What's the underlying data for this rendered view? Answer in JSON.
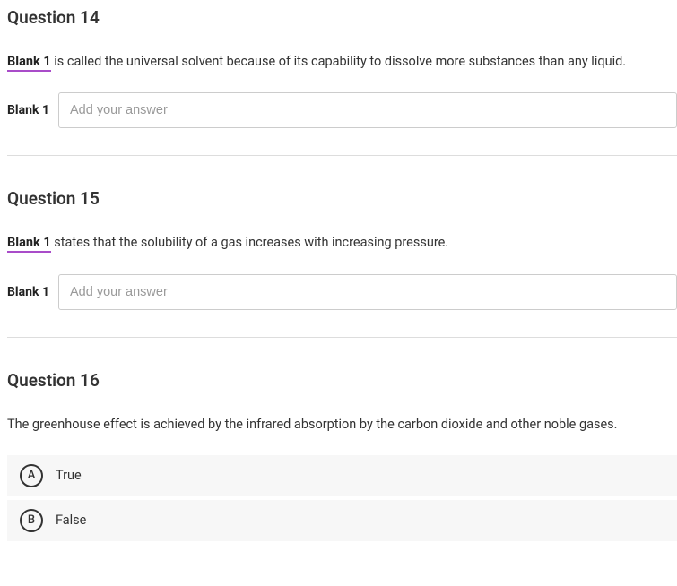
{
  "questions": [
    {
      "title": "Question 14",
      "blank_tag": "Blank 1",
      "text_after": " is called the universal solvent because of its capability to dissolve more substances than any liquid.",
      "input_label": "Blank 1",
      "input_placeholder": "Add your answer"
    },
    {
      "title": "Question 15",
      "blank_tag": "Blank 1",
      "text_after": " states that the solubility of a gas increases with increasing pressure.",
      "input_label": "Blank 1",
      "input_placeholder": "Add your answer"
    },
    {
      "title": "Question 16",
      "prompt": "The greenhouse effect is achieved by the infrared absorption by the carbon dioxide and other noble gases.",
      "options": [
        {
          "letter": "A",
          "label": "True"
        },
        {
          "letter": "B",
          "label": "False"
        }
      ]
    }
  ]
}
